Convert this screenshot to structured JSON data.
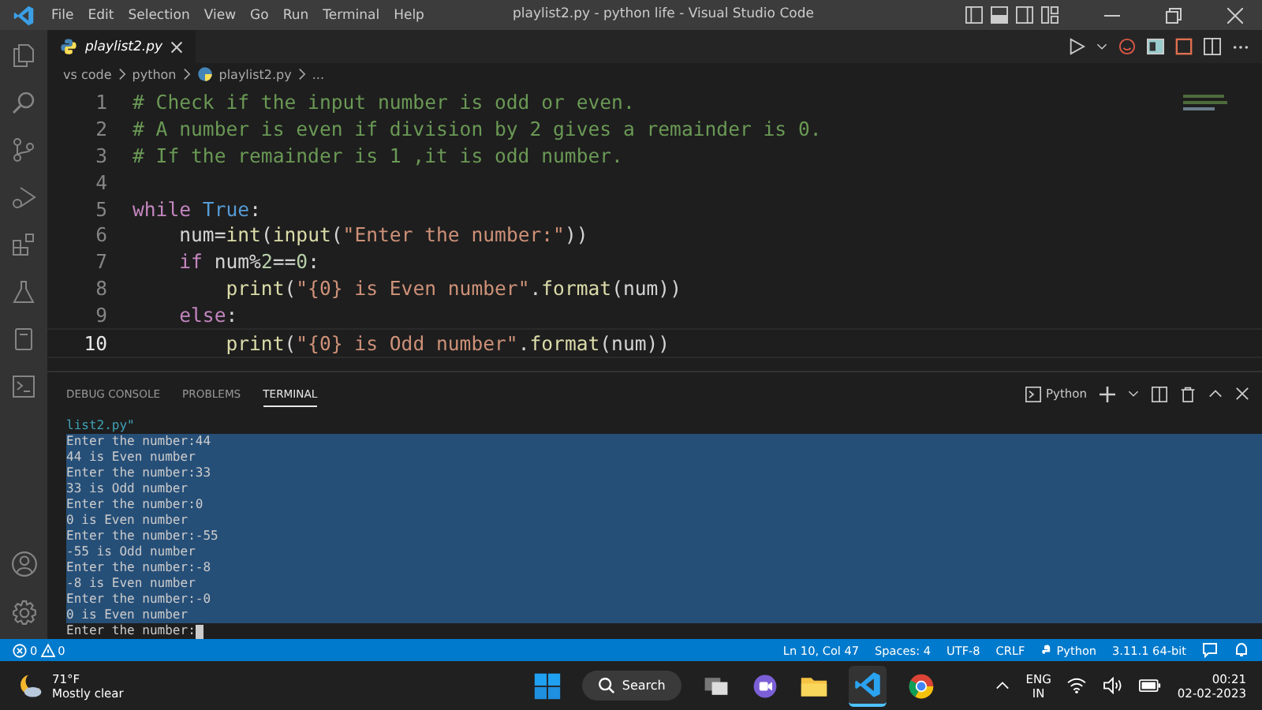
{
  "window": {
    "title": "playlist2.py - python life - Visual Studio Code"
  },
  "menu": [
    "File",
    "Edit",
    "Selection",
    "View",
    "Go",
    "Run",
    "Terminal",
    "Help"
  ],
  "editor_tabs": [
    {
      "label": "playlist2.py",
      "selected": true
    }
  ],
  "breadcrumb": [
    "vs code",
    "python",
    "playlist2.py",
    "..."
  ],
  "code_lines": [
    {
      "number": "1",
      "current": false,
      "tokens": [
        {
          "kind": "comment",
          "text": "# Check if the input number is odd or even."
        }
      ]
    },
    {
      "number": "2",
      "current": false,
      "tokens": [
        {
          "kind": "comment",
          "text": "# A number is even if division by 2 gives a remainder is 0."
        }
      ]
    },
    {
      "number": "3",
      "current": false,
      "tokens": [
        {
          "kind": "comment",
          "text": "# If the remainder is 1 ,it is odd number."
        }
      ]
    },
    {
      "number": "4",
      "current": false
    },
    {
      "number": "5",
      "current": false,
      "tokens": [
        {
          "kind": "keyword",
          "text": "while"
        },
        {
          "kind": "constant",
          "text": " True"
        },
        {
          "kind": "plain",
          "text": ":"
        }
      ]
    },
    {
      "number": "6",
      "current": false,
      "tokens": [
        {
          "kind": "plain",
          "text": "    num="
        },
        {
          "kind": "function",
          "text": "int"
        },
        {
          "kind": "plain",
          "text": "("
        },
        {
          "kind": "function",
          "text": "input"
        },
        {
          "kind": "plain",
          "text": "("
        },
        {
          "kind": "string",
          "text": "\"Enter the number:\""
        },
        {
          "kind": "plain",
          "text": "))"
        }
      ]
    },
    {
      "number": "7",
      "current": false,
      "tokens": [
        {
          "kind": "keyword",
          "text": "    if"
        },
        {
          "kind": "plain",
          "text": " num%"
        },
        {
          "kind": "number",
          "text": "2"
        },
        {
          "kind": "plain",
          "text": "=="
        },
        {
          "kind": "number",
          "text": "0"
        },
        {
          "kind": "plain",
          "text": ":"
        }
      ]
    },
    {
      "number": "8",
      "current": false,
      "tokens": [
        {
          "kind": "function",
          "text": "        print"
        },
        {
          "kind": "plain",
          "text": "("
        },
        {
          "kind": "string",
          "text": "\"{0} is Even number\""
        },
        {
          "kind": "plain",
          "text": "."
        },
        {
          "kind": "function",
          "text": "format"
        },
        {
          "kind": "plain",
          "text": "(num))"
        }
      ]
    },
    {
      "number": "9",
      "current": false,
      "tokens": [
        {
          "kind": "keyword",
          "text": "    else"
        },
        {
          "kind": "plain",
          "text": ":"
        }
      ]
    },
    {
      "number": "10",
      "current": true,
      "tokens": [
        {
          "kind": "function",
          "text": "        print"
        },
        {
          "kind": "plain",
          "text": "("
        },
        {
          "kind": "string",
          "text": "\"{0} is Odd number\""
        },
        {
          "kind": "plain",
          "text": "."
        },
        {
          "kind": "function",
          "text": "format"
        },
        {
          "kind": "plain",
          "text": "(num))"
        }
      ]
    }
  ],
  "panel_tabs": [
    {
      "label": "DEBUG CONSOLE",
      "selected": false
    },
    {
      "label": "PROBLEMS",
      "selected": false
    },
    {
      "label": "TERMINAL",
      "selected": true
    }
  ],
  "terminal_name": "Python",
  "terminal_lines": [
    {
      "text": "list2.py\"",
      "selected": false
    },
    {
      "text": "Enter the number:44",
      "selected": true
    },
    {
      "text": "44 is Even number",
      "selected": true
    },
    {
      "text": "Enter the number:33",
      "selected": true
    },
    {
      "text": "33 is Odd number",
      "selected": true
    },
    {
      "text": "Enter the number:0",
      "selected": true
    },
    {
      "text": "0 is Even number",
      "selected": true
    },
    {
      "text": "Enter the number:-55",
      "selected": true
    },
    {
      "text": "-55 is Odd number",
      "selected": true
    },
    {
      "text": "Enter the number:-8",
      "selected": true
    },
    {
      "text": "-8 is Even number",
      "selected": true
    },
    {
      "text": "Enter the number:-0",
      "selected": true
    },
    {
      "text": "0 is Even number",
      "selected": true
    },
    {
      "text": "Enter the number:",
      "selected": false
    }
  ],
  "status_bar": {
    "errors": "0",
    "warnings": "0",
    "items": [
      "Ln 10, Col 47",
      "Spaces: 4",
      "UTF-8",
      "CRLF",
      "Python",
      "3.11.1 64-bit"
    ]
  },
  "taskbar": {
    "temperature": "71°F",
    "weather": "Mostly clear",
    "search": "Search",
    "language": "ENG",
    "region": "IN",
    "time": "00:21",
    "date": "02-02-2023"
  }
}
